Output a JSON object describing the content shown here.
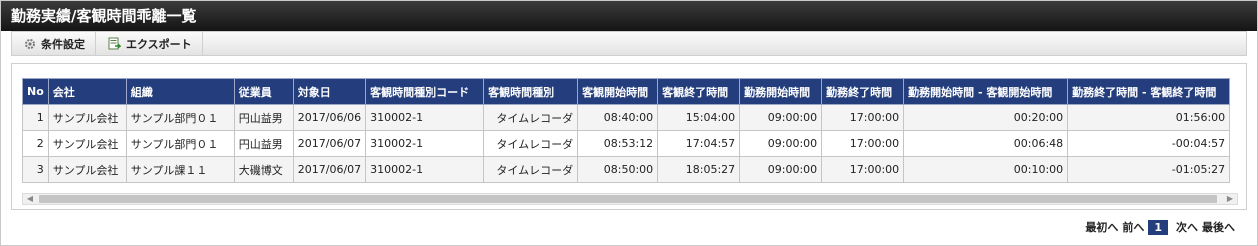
{
  "title": "勤務実績/客観時間乖離一覧",
  "toolbar": {
    "condition_label": "条件設定",
    "export_label": "エクスポート"
  },
  "table": {
    "headers": [
      "No",
      "会社",
      "組織",
      "従業員",
      "対象日",
      "客観時間種別コード",
      "客観時間種別",
      "客観開始時間",
      "客観終了時間",
      "勤務開始時間",
      "勤務終了時間",
      "勤務開始時間 - 客観開始時間",
      "勤務終了時間 - 客観終了時間"
    ],
    "rows": [
      [
        "1",
        "サンプル会社",
        "サンプル部門０１",
        "円山益男",
        "2017/06/06",
        "310002-1",
        "タイムレコーダ",
        "08:40:00",
        "15:04:00",
        "09:00:00",
        "17:00:00",
        "00:20:00",
        "01:56:00"
      ],
      [
        "2",
        "サンプル会社",
        "サンプル部門０１",
        "円山益男",
        "2017/06/07",
        "310002-1",
        "タイムレコーダ",
        "08:53:12",
        "17:04:57",
        "09:00:00",
        "17:00:00",
        "00:06:48",
        "-00:04:57"
      ],
      [
        "3",
        "サンプル会社",
        "サンプル課１１",
        "大磯博文",
        "2017/06/07",
        "310002-1",
        "タイムレコーダ",
        "08:50:00",
        "18:05:27",
        "09:00:00",
        "17:00:00",
        "00:10:00",
        "-01:05:27"
      ]
    ]
  },
  "pager": {
    "first": "最初へ",
    "prev": "前へ",
    "current": "1",
    "next": "次へ",
    "last": "最後へ"
  }
}
